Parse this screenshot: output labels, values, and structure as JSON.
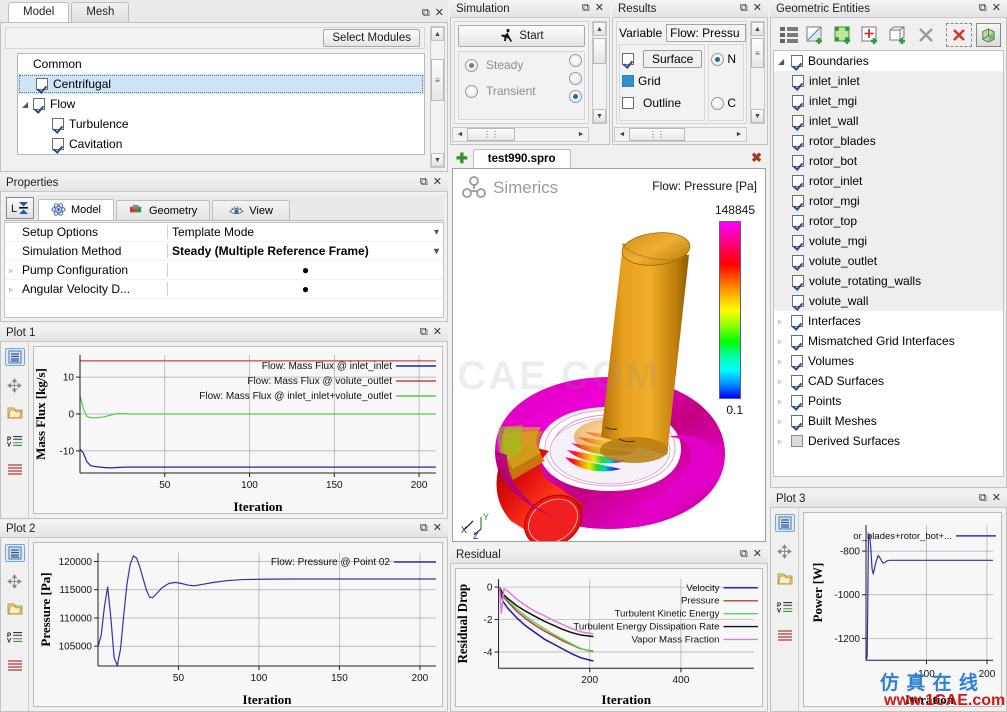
{
  "model_panel": {
    "tabs": [
      {
        "label": "Model",
        "active": true
      },
      {
        "label": "Mesh",
        "active": false
      }
    ],
    "select_modules_label": "Select Modules",
    "tree": [
      {
        "label": "Common",
        "level": 0,
        "checkbox": null,
        "expander": "",
        "selected": false
      },
      {
        "label": "Centrifugal",
        "level": 1,
        "checkbox": true,
        "expander": "",
        "selected": true
      },
      {
        "label": "Flow",
        "level": 0,
        "checkbox": true,
        "expander": "open",
        "selected": false
      },
      {
        "label": "Turbulence",
        "level": 2,
        "checkbox": true,
        "expander": "",
        "selected": false
      },
      {
        "label": "Cavitation",
        "level": 2,
        "checkbox": true,
        "expander": "",
        "selected": false
      }
    ]
  },
  "properties_panel": {
    "title": "Properties",
    "tabs": [
      {
        "label": "Model",
        "icon": "atom-icon",
        "active": true
      },
      {
        "label": "Geometry",
        "icon": "cube-icon",
        "active": false
      },
      {
        "label": "View",
        "icon": "eye-icon",
        "active": false
      }
    ],
    "rows": [
      {
        "name": "Setup Options",
        "value": "Template Mode",
        "dropdown": true,
        "bold": false,
        "expander": false
      },
      {
        "name": "Simulation Method",
        "value": "Steady (Multiple Reference Frame)",
        "dropdown": true,
        "bold": true,
        "expander": false
      },
      {
        "name": "Pump Configuration",
        "value": "●",
        "dropdown": false,
        "bold": false,
        "expander": true
      },
      {
        "name": "Angular Velocity D...",
        "value": "●",
        "dropdown": false,
        "bold": false,
        "expander": true
      }
    ]
  },
  "simulation_panel": {
    "title": "Simulation",
    "start_label": "Start",
    "options": [
      {
        "label": "Steady",
        "selected": true
      },
      {
        "label": "Transient",
        "selected": false
      }
    ]
  },
  "results_panel": {
    "title": "Results",
    "variable_label": "Variable",
    "variable_value": "Flow: Pressu",
    "display_options": [
      {
        "label": "Surface",
        "state": "checked",
        "highlighted": true
      },
      {
        "label": "Grid",
        "state": "filled",
        "highlighted": false
      },
      {
        "label": "Outline",
        "state": "unchecked",
        "highlighted": false
      }
    ],
    "radio_options": [
      {
        "label": "N",
        "selected": true
      },
      {
        "label": "C",
        "selected": false
      }
    ]
  },
  "geometric_entities": {
    "title": "Geometric Entities",
    "toolbar": [
      {
        "name": "list-tree-icon"
      },
      {
        "name": "add-surface-icon"
      },
      {
        "name": "add-region-icon"
      },
      {
        "name": "add-point-icon"
      },
      {
        "name": "add-volume-icon"
      },
      {
        "name": "delete-icon"
      },
      {
        "name": "deselect-all-icon"
      },
      {
        "name": "show-solid-icon"
      }
    ],
    "tree": [
      {
        "label": "Boundaries",
        "level": 0,
        "checkbox": true,
        "expander": "open",
        "shade": false
      },
      {
        "label": "inlet_inlet",
        "level": 1,
        "checkbox": true,
        "expander": "",
        "shade": true
      },
      {
        "label": "inlet_mgi",
        "level": 1,
        "checkbox": true,
        "expander": "",
        "shade": true
      },
      {
        "label": "inlet_wall",
        "level": 1,
        "checkbox": true,
        "expander": "",
        "shade": true
      },
      {
        "label": "rotor_blades",
        "level": 1,
        "checkbox": true,
        "expander": "",
        "shade": true
      },
      {
        "label": "rotor_bot",
        "level": 1,
        "checkbox": true,
        "expander": "",
        "shade": true
      },
      {
        "label": "rotor_inlet",
        "level": 1,
        "checkbox": true,
        "expander": "",
        "shade": true
      },
      {
        "label": "rotor_mgi",
        "level": 1,
        "checkbox": true,
        "expander": "",
        "shade": true
      },
      {
        "label": "rotor_top",
        "level": 1,
        "checkbox": true,
        "expander": "",
        "shade": true
      },
      {
        "label": "volute_mgi",
        "level": 1,
        "checkbox": true,
        "expander": "",
        "shade": true
      },
      {
        "label": "volute_outlet",
        "level": 1,
        "checkbox": true,
        "expander": "",
        "shade": true
      },
      {
        "label": "volute_rotating_walls",
        "level": 1,
        "checkbox": true,
        "expander": "",
        "shade": true
      },
      {
        "label": "volute_wall",
        "level": 1,
        "checkbox": true,
        "expander": "",
        "shade": true
      },
      {
        "label": "Interfaces",
        "level": 0,
        "checkbox": true,
        "expander": "closed",
        "shade": false
      },
      {
        "label": "Mismatched Grid Interfaces",
        "level": 0,
        "checkbox": true,
        "expander": "closed",
        "shade": false
      },
      {
        "label": "Volumes",
        "level": 0,
        "checkbox": true,
        "expander": "closed",
        "shade": false
      },
      {
        "label": "CAD Surfaces",
        "level": 0,
        "checkbox": true,
        "expander": "closed",
        "shade": false
      },
      {
        "label": "Points",
        "level": 0,
        "checkbox": true,
        "expander": "closed",
        "shade": false
      },
      {
        "label": "Built Meshes",
        "level": 0,
        "checkbox": true,
        "expander": "closed",
        "shade": false
      },
      {
        "label": "Derived Surfaces",
        "level": 0,
        "checkbox": false,
        "expander": "closed",
        "shade": false
      }
    ]
  },
  "viewport": {
    "tab_label": "test990.spro",
    "brand": "Simerics",
    "legend_title": "Flow: Pressure [Pa]",
    "legend_max": "148845",
    "legend_min": "0.1",
    "axis_labels": [
      "X",
      "Y",
      "Z"
    ],
    "colorbar_stops": [
      "#ff00ff",
      "#ff0000",
      "#ff7f00",
      "#ffff00",
      "#00ff00",
      "#00ffff",
      "#0000ff"
    ]
  },
  "plot1": {
    "title": "Plot 1",
    "tools": [
      "list-icon",
      "move-icon",
      "folder-icon",
      "properties-icon",
      "lines-icon"
    ]
  },
  "plot2": {
    "title": "Plot 2",
    "tools": [
      "list-icon",
      "move-icon",
      "folder-icon",
      "properties-icon",
      "lines-icon"
    ]
  },
  "plot3": {
    "title": "Plot 3",
    "tools": [
      "list-icon",
      "move-icon",
      "folder-icon",
      "properties-icon",
      "lines-icon"
    ]
  },
  "residual_panel": {
    "title": "Residual"
  },
  "watermarks": {
    "center": "1CAE.COM",
    "cn_text": "仿 真 在 线",
    "site": "www.1CAE.com"
  },
  "chart_data": [
    {
      "id": "plot1",
      "type": "line",
      "title": "Plot 1",
      "xlabel": "Iteration",
      "ylabel": "Mass Flux [kg/s]",
      "xlim": [
        0,
        210
      ],
      "ylim": [
        -16,
        16
      ],
      "xticks": [
        50,
        100,
        150,
        200
      ],
      "yticks": [
        -10,
        0,
        10
      ],
      "grid": true,
      "legend_position": "top-right",
      "series": [
        {
          "name": "Flow: Mass Flux @ inlet_inlet",
          "color": "#2222aa",
          "x": [
            0,
            2,
            4,
            6,
            8,
            10,
            14,
            18,
            22,
            26,
            30,
            40,
            60,
            100,
            150,
            210
          ],
          "values": [
            -9.5,
            -10.6,
            -12.9,
            -13.9,
            -14.2,
            -14.3,
            -14.5,
            -14.6,
            -14.5,
            -14.4,
            -14.4,
            -14.4,
            -14.4,
            -14.4,
            -14.4,
            -14.4
          ]
        },
        {
          "name": "Flow: Mass Flux @ volute_outlet",
          "color": "#cc4444",
          "x": [
            0,
            4,
            10,
            30,
            60,
            100,
            150,
            210
          ],
          "values": [
            14.4,
            14.4,
            14.4,
            14.4,
            14.4,
            14.4,
            14.4,
            14.4
          ]
        },
        {
          "name": "Flow: Mass Flux @ inlet_inlet+volute_outlet",
          "color": "#4ccf4c",
          "x": [
            0,
            2,
            4,
            6,
            10,
            14,
            18,
            22,
            26,
            30,
            40,
            60,
            100,
            150,
            210
          ],
          "values": [
            5.0,
            1.4,
            -0.6,
            -1.0,
            -1.0,
            -0.8,
            -0.3,
            0.15,
            0.1,
            0.0,
            0.0,
            0.0,
            0.0,
            0.0,
            0.0
          ]
        }
      ]
    },
    {
      "id": "plot2",
      "type": "line",
      "title": "Plot 2",
      "xlabel": "Iteration",
      "ylabel": "Pressure [Pa]",
      "xlim": [
        0,
        210
      ],
      "ylim": [
        101500,
        121500
      ],
      "xticks": [
        50,
        100,
        150,
        200
      ],
      "yticks": [
        105000,
        110000,
        115000,
        120000
      ],
      "grid": true,
      "legend_position": "top-right",
      "series": [
        {
          "name": "Flow: Pressure @ Point 02",
          "color": "#3333aa",
          "x": [
            0,
            2,
            4,
            6,
            8,
            10,
            12,
            14,
            16,
            18,
            20,
            22,
            24,
            26,
            28,
            30,
            32,
            34,
            36,
            40,
            44,
            48,
            52,
            56,
            60,
            66,
            72,
            80,
            90,
            100,
            120,
            150,
            180,
            210
          ],
          "values": [
            104900,
            107000,
            112000,
            115500,
            110000,
            103000,
            101600,
            104500,
            110500,
            116000,
            119500,
            121000,
            120600,
            119000,
            117000,
            115000,
            113700,
            113600,
            114200,
            115400,
            116100,
            116300,
            116100,
            115800,
            115700,
            116000,
            116300,
            116600,
            116800,
            116850,
            116900,
            116900,
            116900,
            116900
          ]
        }
      ]
    },
    {
      "id": "residual",
      "type": "line",
      "title": "Residual",
      "xlabel": "Iteration",
      "ylabel": "Residual Drop",
      "xlim": [
        0,
        560
      ],
      "ylim": [
        -5,
        0.5
      ],
      "xticks": [
        200,
        400
      ],
      "yticks": [
        0,
        -2,
        -4
      ],
      "grid": true,
      "legend_position": "top-right",
      "series": [
        {
          "name": "Velocity",
          "color": "#1a1aa8",
          "x": [
            2,
            10,
            20,
            40,
            60,
            80,
            100,
            120,
            140,
            160,
            180,
            200,
            208
          ],
          "values": [
            0.0,
            -0.9,
            -1.3,
            -1.9,
            -2.4,
            -2.8,
            -3.2,
            -3.5,
            -3.8,
            -4.1,
            -4.35,
            -4.5,
            -4.55
          ]
        },
        {
          "name": "Pressure",
          "color": "#b8402a",
          "x": [
            2,
            10,
            20,
            40,
            60,
            80,
            100,
            120,
            140,
            160,
            180,
            200,
            208
          ],
          "values": [
            0.0,
            -0.6,
            -0.9,
            -1.5,
            -1.95,
            -2.35,
            -2.7,
            -3.0,
            -3.3,
            -3.55,
            -3.8,
            -3.92,
            -3.95
          ]
        },
        {
          "name": "Turbulent Kinetic Energy",
          "color": "#63d063",
          "x": [
            2,
            10,
            20,
            40,
            60,
            80,
            100,
            120,
            140,
            160,
            180,
            200,
            208
          ],
          "values": [
            0.0,
            -0.5,
            -0.8,
            -1.35,
            -1.8,
            -2.2,
            -2.55,
            -2.9,
            -3.2,
            -3.5,
            -3.78,
            -3.95,
            -4.0
          ]
        },
        {
          "name": "Turbulent Energy Dissipation Rate",
          "color": "#111111",
          "x": [
            2,
            10,
            20,
            40,
            60,
            80,
            100,
            120,
            140,
            160,
            180,
            200,
            208
          ],
          "values": [
            0.0,
            -0.45,
            -0.7,
            -1.15,
            -1.5,
            -1.8,
            -2.1,
            -2.35,
            -2.6,
            -2.8,
            -2.95,
            -3.02,
            -3.05
          ]
        },
        {
          "name": "Vapor Mass Fraction",
          "color": "#dd7fd8",
          "x": [
            2,
            6,
            12,
            20,
            40,
            60,
            80,
            100,
            120,
            140,
            160,
            180,
            200,
            208
          ],
          "values": [
            0.0,
            -1.6,
            -0.1,
            -0.25,
            -0.75,
            -1.15,
            -1.5,
            -1.75,
            -2.05,
            -2.3,
            -2.55,
            -2.75,
            -2.85,
            -2.88
          ]
        }
      ]
    },
    {
      "id": "plot3",
      "type": "line",
      "title": "Plot 3",
      "xlabel": "Iteration",
      "ylabel": "Power [W]",
      "xlim": [
        0,
        210
      ],
      "ylim": [
        -1300,
        -680
      ],
      "xticks": [
        100,
        200
      ],
      "yticks": [
        -800,
        -1000,
        -1200
      ],
      "grid": true,
      "legend_position": "top-right",
      "series": [
        {
          "name": "or_blades+rotor_bot+...",
          "color": "#3333aa",
          "x": [
            0,
            2,
            4,
            6,
            8,
            10,
            12,
            16,
            20,
            24,
            28,
            32,
            36,
            40,
            50,
            70,
            100,
            150,
            210
          ],
          "values": [
            -1300,
            -1280,
            -740,
            -725,
            -790,
            -880,
            -905,
            -855,
            -820,
            -835,
            -855,
            -850,
            -843,
            -842,
            -842,
            -842,
            -842,
            -842,
            -842
          ]
        }
      ]
    }
  ]
}
